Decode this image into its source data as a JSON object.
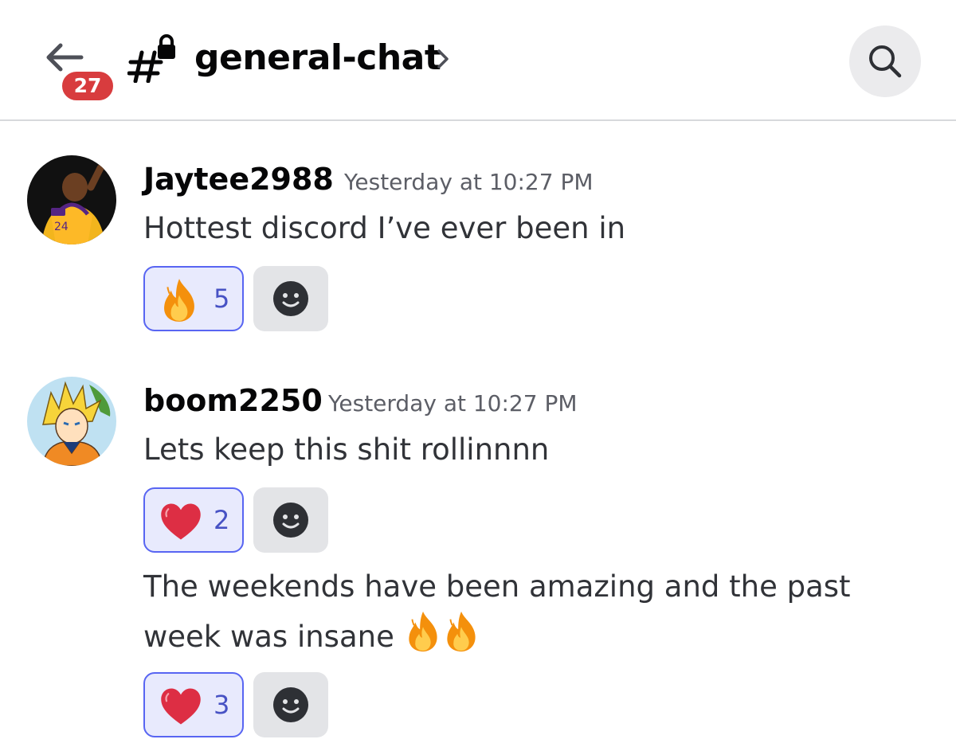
{
  "header": {
    "unread_count": "27",
    "channel_name": "general-chat"
  },
  "messages": [
    {
      "username": "Jaytee2988",
      "timestamp": "Yesterday at 10:27 PM",
      "texts": [
        "Hottest discord I’ve ever been in"
      ],
      "reactions": [
        {
          "emoji": "fire",
          "count": "5"
        }
      ]
    },
    {
      "username": "boom2250",
      "timestamp": "Yesterday at 10:27 PM",
      "texts": [
        "Lets keep this shit rollinnnn",
        "The weekends have been amazing and the past",
        "week was insane"
      ],
      "reactions": [
        {
          "emoji": "red-heart",
          "count": "2"
        },
        {
          "emoji": "red-heart",
          "count": "3"
        }
      ]
    }
  ],
  "icons": {
    "back": "arrow-left-icon",
    "channel": "locked-text-channel-icon",
    "search": "magnifier-icon",
    "add_reaction": "smiley-face-icon"
  },
  "colors": {
    "badge": "#d83c3e",
    "reaction_border": "#5865f2",
    "reaction_bg": "#e8eafd",
    "reaction_count": "#4752c4"
  }
}
